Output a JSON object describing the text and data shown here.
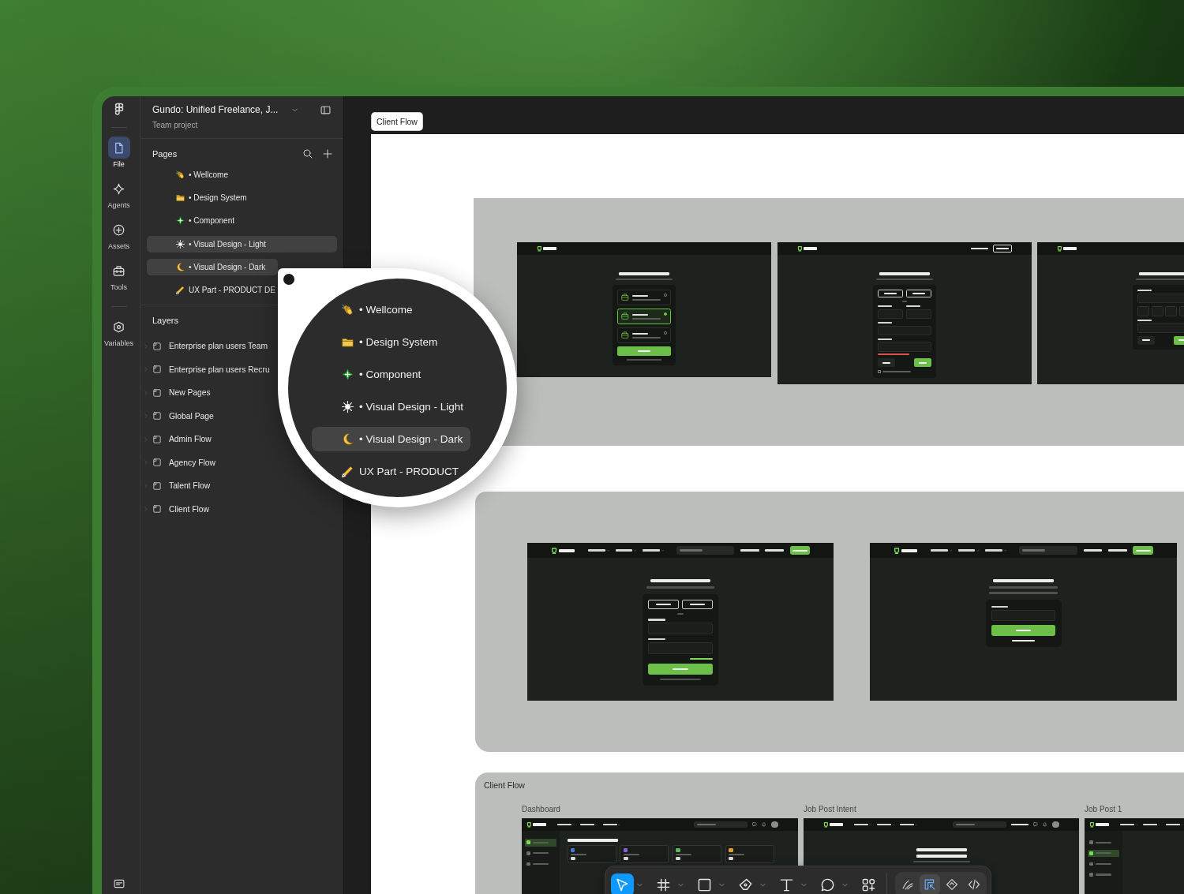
{
  "project": {
    "title": "Gundo: Unified Freelance, J...",
    "subtitle": "Team project"
  },
  "rail": {
    "main": [
      {
        "kind": "file",
        "label": "File",
        "selected": true
      },
      {
        "kind": "agents",
        "label": "Agents",
        "selected": false
      },
      {
        "kind": "assets",
        "label": "Assets",
        "selected": false
      },
      {
        "kind": "tools",
        "label": "Tools",
        "selected": false
      }
    ],
    "extra": [
      {
        "kind": "variables",
        "label": "Variables",
        "selected": false
      }
    ]
  },
  "pages": {
    "heading": "Pages",
    "items": [
      {
        "kind": "clap",
        "name": "• Wellcome",
        "selected": false
      },
      {
        "kind": "folder",
        "name": "• Design System",
        "selected": false
      },
      {
        "kind": "sparkle",
        "name": "• Component",
        "selected": false
      },
      {
        "kind": "sun",
        "name": "• Visual Design - Light",
        "selected": true
      },
      {
        "kind": "moon",
        "name": "• Visual Design - Dark",
        "selected": true
      },
      {
        "kind": "pencil",
        "name": "UX Part - PRODUCT DE",
        "selected": false
      }
    ]
  },
  "layers": {
    "heading": "Layers",
    "items": [
      {
        "name": "Enterprise plan users Team",
        "expanded": false
      },
      {
        "name": "Enterprise plan users Recru",
        "expanded": false
      },
      {
        "name": "New Pages",
        "expanded": false
      },
      {
        "name": "Global Page",
        "expanded": false
      },
      {
        "name": "Admin Flow",
        "expanded": false
      },
      {
        "name": "Agency Flow",
        "expanded": false
      },
      {
        "name": "Talent Flow",
        "expanded": false
      },
      {
        "name": "Client Flow",
        "expanded": false
      }
    ]
  },
  "magnifier": {
    "items": [
      {
        "kind": "clap",
        "name": "• Wellcome",
        "selected": false
      },
      {
        "kind": "folder",
        "name": "• Design System",
        "selected": false
      },
      {
        "kind": "sparkle",
        "name": "• Component",
        "selected": false
      },
      {
        "kind": "sun",
        "name": "• Visual Design - Light",
        "selected": false
      },
      {
        "kind": "moon",
        "name": "• Visual Design - Dark",
        "selected": true
      },
      {
        "kind": "pencil",
        "name": "UX Part - PRODUCT",
        "selected": false
      }
    ]
  },
  "canvas": {
    "frame_label": "Client Flow",
    "sections": [
      {
        "frames": [
          {
            "kind": "choice",
            "header": {
              "kind": "brand"
            },
            "options": [
              {
                "selected": false
              },
              {
                "selected": true
              },
              {
                "selected": false
              }
            ]
          },
          {
            "kind": "signup",
            "header": {
              "kind": "talent"
            },
            "consent": {
              "checked": false
            }
          },
          {
            "kind": "company",
            "header": {
              "kind": "brand"
            }
          }
        ]
      },
      {
        "frames": [
          {
            "kind": "login",
            "header": {
              "kind": "public"
            }
          },
          {
            "kind": "reset",
            "header": {
              "kind": "public"
            }
          }
        ]
      },
      {
        "label": "Client Flow",
        "frames": [
          {
            "label": "Dashboard",
            "kind": "dashboard",
            "header": {
              "kind": "member"
            },
            "sidebar": [
              {
                "selected": true
              },
              {
                "selected": false
              },
              {
                "selected": false
              }
            ],
            "stats": [
              {
                "color": "#3d7be0"
              },
              {
                "color": "#8a63d2"
              },
              {
                "color": "#5cb85c"
              },
              {
                "color": "#e0a030"
              }
            ]
          },
          {
            "label": "Job Post Intent",
            "kind": "intent",
            "header": {
              "kind": "member-talent"
            }
          },
          {
            "label": "Job Post 1",
            "kind": "workspace",
            "header": {
              "kind": "workspace"
            },
            "sidebar": [
              {
                "selected": false
              },
              {
                "selected": true
              },
              {
                "selected": false
              },
              {
                "selected": false
              }
            ]
          }
        ]
      }
    ]
  },
  "toolbar": {
    "tools": [
      {
        "kind": "move",
        "selected": true,
        "menu": true
      },
      {
        "kind": "frame",
        "selected": false,
        "menu": true
      },
      {
        "kind": "rectangle",
        "selected": false,
        "menu": true
      },
      {
        "kind": "pen",
        "selected": false,
        "menu": true
      },
      {
        "kind": "text",
        "selected": false,
        "menu": true
      },
      {
        "kind": "comment",
        "selected": false,
        "menu": true
      },
      {
        "kind": "actions",
        "selected": false,
        "menu": false
      }
    ],
    "modes": [
      {
        "kind": "draw",
        "selected": false
      },
      {
        "kind": "design",
        "selected": true
      },
      {
        "kind": "dev",
        "selected": false
      },
      {
        "kind": "code",
        "selected": false
      }
    ]
  }
}
